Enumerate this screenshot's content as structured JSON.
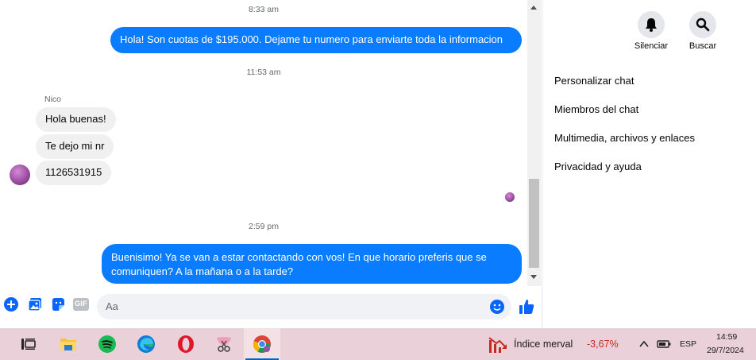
{
  "chat": {
    "messages": [
      {
        "type": "timestamp",
        "text": "8:33 am"
      },
      {
        "type": "outgoing",
        "text": "Hola! Son cuotas de $195.000. Dejame tu numero para enviarte toda la informacion"
      },
      {
        "type": "timestamp",
        "text": "11:53 am"
      },
      {
        "type": "sender_name",
        "text": "Nico"
      },
      {
        "type": "incoming",
        "text": "Hola buenas!"
      },
      {
        "type": "incoming",
        "text": "Te dejo mi nr"
      },
      {
        "type": "incoming",
        "text": "1126531915"
      },
      {
        "type": "timestamp",
        "text": "2:59 pm"
      },
      {
        "type": "outgoing",
        "text": "Buenisimo! Ya se van a estar contactando con vos! En que horario preferis que se comuniquen? A la mañana o a la tarde?"
      }
    ]
  },
  "composer": {
    "placeholder": "Aa",
    "icons": [
      "plus-circle-icon",
      "photo-icon",
      "sticker-icon",
      "gif-icon",
      "emoji-icon",
      "thumbs-up-icon"
    ],
    "gif_label": "GIF"
  },
  "sidebar": {
    "actions": [
      {
        "label": "Silenciar",
        "icon": "bell-icon"
      },
      {
        "label": "Buscar",
        "icon": "search-icon"
      }
    ],
    "menu": [
      {
        "label": "Personalizar chat"
      },
      {
        "label": "Miembros del chat"
      },
      {
        "label": "Multimedia, archivos y enlaces"
      },
      {
        "label": "Privacidad y ayuda"
      }
    ]
  },
  "taskbar": {
    "apps": [
      "task-view-icon",
      "file-explorer-icon",
      "spotify-icon",
      "edge-icon",
      "opera-icon",
      "snipping-tool-icon",
      "chrome-icon"
    ],
    "ticker": {
      "label": "Índice merval",
      "value": "-3,67%"
    },
    "language": "ESP",
    "time": "14:59",
    "date": "29/7/2024"
  },
  "colors": {
    "outgoing_bubble": "#0a7cff",
    "incoming_bubble": "#f0f0f0",
    "accent": "#0866ff",
    "taskbar": "#ead0d8",
    "ticker_negative": "#c42b1c"
  }
}
